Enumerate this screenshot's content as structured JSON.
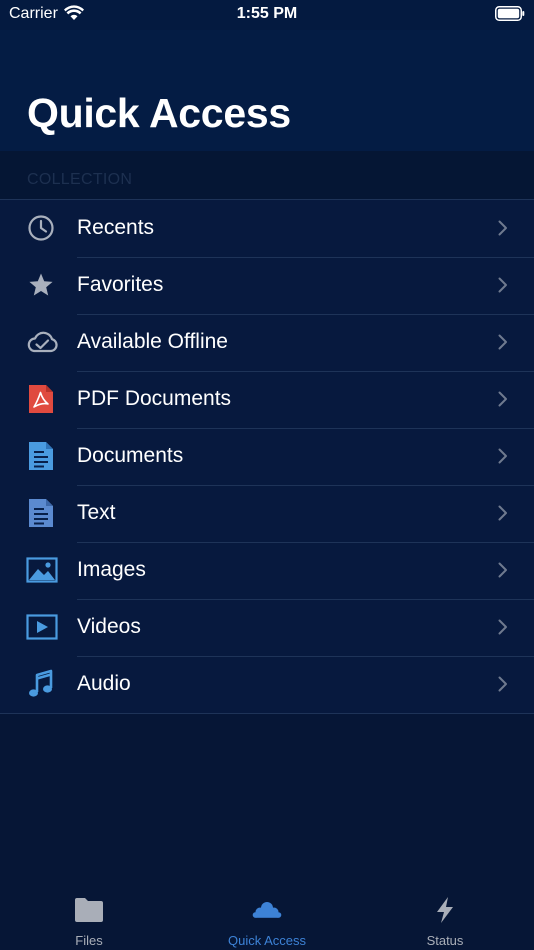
{
  "status": {
    "carrier": "Carrier",
    "time": "1:55 PM"
  },
  "header": {
    "title": "Quick Access"
  },
  "section": {
    "label": "COLLECTION"
  },
  "items": [
    {
      "label": "Recents",
      "icon": "clock-icon"
    },
    {
      "label": "Favorites",
      "icon": "star-icon"
    },
    {
      "label": "Available Offline",
      "icon": "cloud-check-icon"
    },
    {
      "label": "PDF Documents",
      "icon": "pdf-icon"
    },
    {
      "label": "Documents",
      "icon": "document-icon"
    },
    {
      "label": "Text",
      "icon": "text-file-icon"
    },
    {
      "label": "Images",
      "icon": "image-icon"
    },
    {
      "label": "Videos",
      "icon": "video-icon"
    },
    {
      "label": "Audio",
      "icon": "music-note-icon"
    }
  ],
  "tabs": [
    {
      "label": "Files",
      "icon": "folder-icon",
      "active": false
    },
    {
      "label": "Quick Access",
      "icon": "cloud-icon",
      "active": true
    },
    {
      "label": "Status",
      "icon": "bolt-icon",
      "active": false
    }
  ],
  "colors": {
    "background": "#061636",
    "header": "#041c44",
    "accent": "#3d82d6",
    "pdf_red": "#e04a3f",
    "doc_blue": "#4a9be0"
  }
}
